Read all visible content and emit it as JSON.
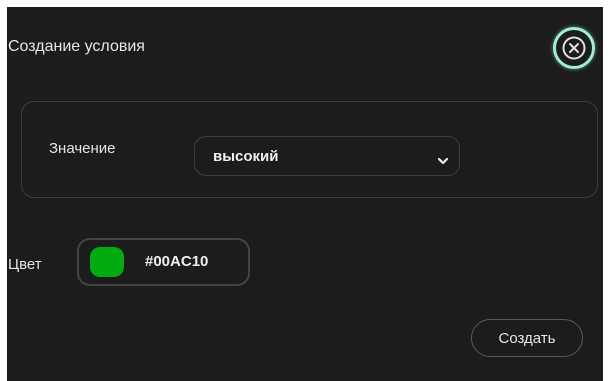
{
  "dialog": {
    "title": "Создание условия",
    "close_icon": "close-circle-icon"
  },
  "value_section": {
    "label": "Значение",
    "selected": "высокий",
    "dropdown_icon": "chevron-down-icon"
  },
  "color_section": {
    "label": "Цвет",
    "hex": "#00AC10",
    "swatch_color": "#00AC10"
  },
  "actions": {
    "create_label": "Создать"
  },
  "colors": {
    "background": "#1c1c1c",
    "focus_ring": "#9ef0d2",
    "border": "#3e3e3e",
    "text": "#e6e6e6"
  }
}
